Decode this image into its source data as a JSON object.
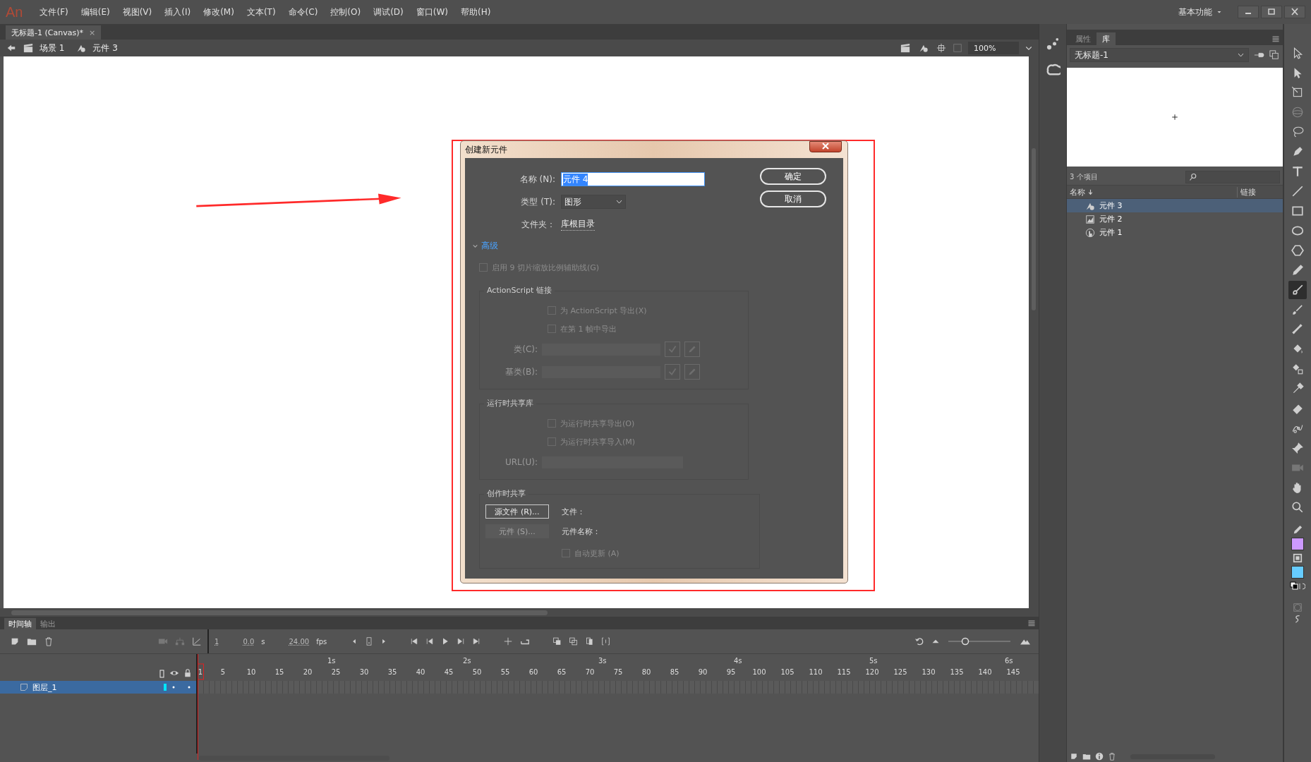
{
  "app": {
    "logo": "An",
    "menu": [
      "文件(F)",
      "编辑(E)",
      "视图(V)",
      "插入(I)",
      "修改(M)",
      "文本(T)",
      "命令(C)",
      "控制(O)",
      "调试(D)",
      "窗口(W)",
      "帮助(H)"
    ],
    "workspace": "基本功能"
  },
  "document_tab": {
    "title": "无标题-1 (Canvas)*",
    "close": "×"
  },
  "edit_bar": {
    "breadcrumbs": [
      {
        "label": "场景 1",
        "kind": "scene"
      },
      {
        "label": "元件 3",
        "kind": "symbol"
      }
    ],
    "zoom": "100%"
  },
  "dialog": {
    "title": "创建新元件",
    "name_label": "名称 (N):",
    "name_value": "元件 4",
    "type_label": "类型 (T):",
    "type_value": "图形",
    "folder_label": "文件夹：",
    "folder_value": "库根目录",
    "buttons": [
      "确定",
      "取消"
    ],
    "advanced": "高级",
    "expanded": true,
    "nine_slice": {
      "label": "启用 9 切片缩放比例辅助线(G)",
      "checked": false,
      "disabled": true
    },
    "actionscript": {
      "title": "ActionScript 链接",
      "checkboxes": [
        {
          "label": "为 ActionScript 导出(X)",
          "checked": false,
          "disabled": true
        },
        {
          "label": "在第 1 帧中导出",
          "checked": false,
          "disabled": true
        }
      ],
      "fields": [
        {
          "label": "类(C):",
          "disabled": true
        },
        {
          "label": "基类(B):",
          "disabled": true
        }
      ]
    },
    "runtime": {
      "title": "运行时共享库",
      "checkboxes": [
        {
          "label": "为运行时共享导出(O)",
          "checked": false,
          "disabled": true
        },
        {
          "label": "为运行时共享导入(M)",
          "checked": false,
          "disabled": true
        }
      ],
      "url_label": "URL(U):"
    },
    "authortime": {
      "title": "创作时共享",
      "buttons": [
        {
          "label": "源文件 (R)...",
          "disabled": false
        },
        {
          "label": "元件 (S)...",
          "disabled": true
        }
      ],
      "file_label": "文件：",
      "symbol_name_label": "元件名称：",
      "auto_update": {
        "label": "自动更新 (A)",
        "checked": false,
        "disabled": true
      }
    }
  },
  "library": {
    "tabs": [
      {
        "label": "属性",
        "selected": false
      },
      {
        "label": "库",
        "selected": true
      }
    ],
    "document": "无标题-1",
    "item_count": "3 个项目",
    "columns": [
      "名称",
      "链接"
    ],
    "items": [
      {
        "name": "元件 3",
        "kind": "graphic",
        "selected": true
      },
      {
        "name": "元件 2",
        "kind": "movieclip",
        "selected": false
      },
      {
        "name": "元件 1",
        "kind": "button",
        "selected": false
      }
    ]
  },
  "tools": [
    {
      "kind": "selection",
      "selected": false
    },
    {
      "kind": "subselection",
      "selected": false
    },
    {
      "kind": "transform",
      "selected": false
    },
    {
      "kind": "rotate3d",
      "selected": false
    },
    {
      "kind": "lasso",
      "selected": false
    },
    {
      "kind": "pen",
      "selected": false
    },
    {
      "kind": "text",
      "selected": false
    },
    {
      "kind": "line",
      "selected": false
    },
    {
      "kind": "rect",
      "selected": false
    },
    {
      "kind": "oval",
      "selected": false
    },
    {
      "kind": "polygon",
      "selected": false
    },
    {
      "kind": "pencil",
      "selected": false
    },
    {
      "kind": "brush",
      "selected": true
    },
    {
      "kind": "paintbrush",
      "selected": false
    },
    {
      "kind": "bone",
      "selected": false
    },
    {
      "kind": "bucket",
      "selected": false
    },
    {
      "kind": "inkbottle",
      "selected": false
    },
    {
      "kind": "eyedropper",
      "selected": false
    },
    {
      "kind": "eraser",
      "selected": false
    },
    {
      "kind": "width",
      "selected": false
    },
    {
      "kind": "pin",
      "selected": false
    },
    {
      "kind": "camera",
      "selected": false
    },
    {
      "kind": "hand",
      "selected": false
    },
    {
      "kind": "zoom",
      "selected": false
    }
  ],
  "swatches": [
    {
      "kind": "stroke",
      "color": "#cc99ff"
    },
    {
      "kind": "fill",
      "color": "#66ccff"
    }
  ],
  "timeline": {
    "tabs": [
      {
        "label": "时间轴",
        "selected": true
      },
      {
        "label": "输出",
        "selected": false
      }
    ],
    "zoom_slider": {
      "level": 0.25
    },
    "frame": "1",
    "time": "0.0",
    "time_unit": "s",
    "fps": "24.00",
    "fps_unit": "fps",
    "seconds": [
      "1s",
      "2s",
      "3s",
      "4s",
      "5s",
      "6s"
    ],
    "frame_numbers": [
      "1",
      "5",
      "10",
      "15",
      "20",
      "25",
      "30",
      "35",
      "40",
      "45",
      "50",
      "55",
      "60",
      "65",
      "70",
      "75",
      "80",
      "85",
      "90",
      "95",
      "100",
      "105",
      "110",
      "115",
      "120",
      "125",
      "130",
      "135",
      "140",
      "145"
    ],
    "layers": [
      {
        "name": "图层_1",
        "selected": true,
        "color": "#00e5ff"
      }
    ]
  }
}
